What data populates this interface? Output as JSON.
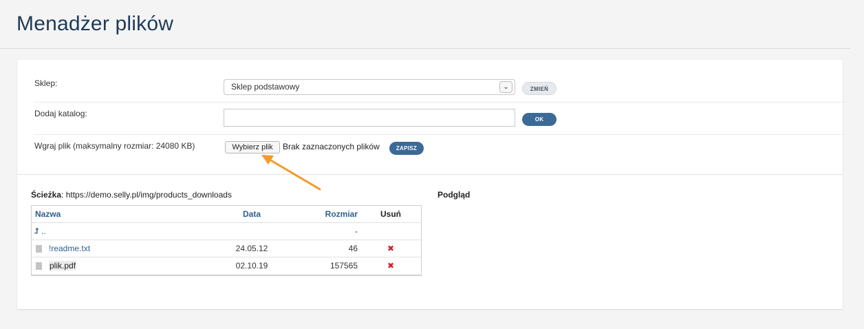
{
  "page": {
    "title": "Menadżer plików"
  },
  "form": {
    "shop": {
      "label": "Sklep:",
      "selected": "Sklep podstawowy",
      "button": "ZMIEŃ"
    },
    "add_dir": {
      "label": "Dodaj katalog:",
      "value": "",
      "button": "OK"
    },
    "upload": {
      "label": "Wgraj plik (maksymalny rozmiar: 24080 KB)",
      "choose_button": "Wybierz plik",
      "no_file": "Brak zaznaczonych plików",
      "button": "ZAPISZ"
    }
  },
  "browser": {
    "path_label": "Ścieżka",
    "path_value": ": https://demo.selly.pl/img/products_downloads",
    "preview_label": "Podgląd",
    "columns": {
      "name": "Nazwa",
      "date": "Data",
      "size": "Rozmiar",
      "delete": "Usuń"
    },
    "parent": {
      "name": "..",
      "size": "-"
    },
    "files": [
      {
        "name": "!readme.txt",
        "date": "24.05.12",
        "size": "46",
        "delete": "✖"
      },
      {
        "name": "plik.pdf",
        "date": "02.10.19",
        "size": "157565",
        "delete": "✖"
      }
    ]
  },
  "icons": {
    "chevron": "chevron-down-icon",
    "up": "level-up-icon",
    "file": "file-icon",
    "delete": "delete-x-icon",
    "annotation": "arrow-annotation-icon"
  },
  "colors": {
    "accent": "#3c6a96",
    "link": "#2e5e8e",
    "delete": "#d0202a",
    "annotation": "#f39a2a"
  }
}
